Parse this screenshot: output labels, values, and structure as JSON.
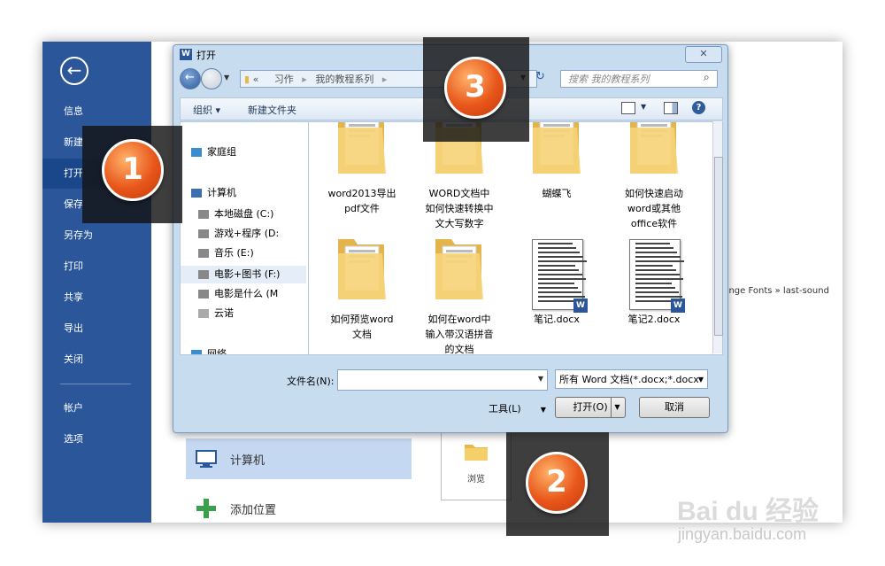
{
  "backstage": {
    "nav": [
      "信息",
      "新建",
      "打开",
      "保存",
      "另存为",
      "打印",
      "共享",
      "导出",
      "关闭",
      "帐户",
      "选项"
    ],
    "active_index": 2,
    "places": [
      {
        "label": "计算机",
        "selected": true,
        "icon": "computer-icon"
      },
      {
        "label": "添加位置",
        "selected": false,
        "icon": "plus-icon"
      }
    ],
    "browse_label": "浏览",
    "recent_crumb": "runge Fonts » last-sound"
  },
  "dialog": {
    "title": "打开",
    "breadcrumb": [
      "«",
      "习作",
      "▸",
      "我的教程系列",
      "▸"
    ],
    "search_placeholder": "搜索 我的教程系列",
    "toolbar": {
      "organize": "组织 ▾",
      "new_folder": "新建文件夹"
    },
    "nav_items": [
      {
        "label": "家庭组",
        "icon": "homegroup-icon",
        "selected": false
      },
      {
        "label": "计算机",
        "icon": "computer-icon",
        "selected": false
      },
      {
        "label": "本地磁盘 (C:)",
        "icon": "drive-icon",
        "selected": false
      },
      {
        "label": "游戏+程序 (D:",
        "icon": "drive-icon",
        "selected": false
      },
      {
        "label": "音乐 (E:)",
        "icon": "drive-icon",
        "selected": false
      },
      {
        "label": "电影+图书 (F:)",
        "icon": "drive-icon",
        "selected": true
      },
      {
        "label": "电影是什么 (M",
        "icon": "drive-icon",
        "selected": false
      },
      {
        "label": "云诺",
        "icon": "cloud-icon",
        "selected": false
      },
      {
        "label": "网络",
        "icon": "network-icon",
        "selected": false
      }
    ],
    "files": [
      {
        "name": "word2013导出\npdf文件",
        "kind": "folder"
      },
      {
        "name": "WORD文档中\n如何快速转换中\n文大写数字",
        "kind": "folder"
      },
      {
        "name": "蝴蝶飞",
        "kind": "folder"
      },
      {
        "name": "如何快速启动\nword或其他\noffice软件",
        "kind": "folder"
      },
      {
        "name": "如何预览word\n文档",
        "kind": "folder"
      },
      {
        "name": "如何在word中\n输入带汉语拼音\n的文档",
        "kind": "folder"
      },
      {
        "name": "笔记.docx",
        "kind": "doc"
      },
      {
        "name": "笔记2.docx",
        "kind": "doc"
      }
    ],
    "filename_label": "文件名(N):",
    "filename_value": "",
    "filetype": "所有 Word 文档(*.docx;*.docx",
    "tools_label": "工具(L)",
    "open_label": "打开(O)",
    "cancel_label": "取消"
  },
  "callouts": [
    "1",
    "2",
    "3"
  ],
  "watermark": {
    "brand": "Bai du 经验",
    "url": "jingyan.baidu.com"
  }
}
